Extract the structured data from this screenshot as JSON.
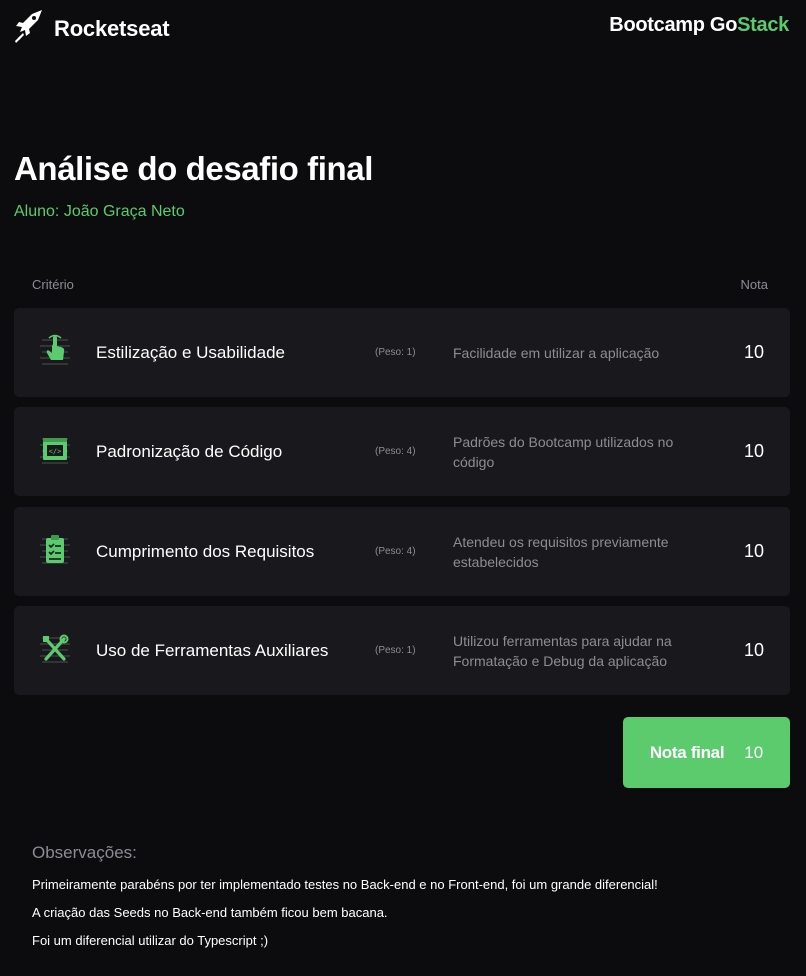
{
  "header": {
    "brand": "Rocketseat",
    "bootcamp_prefix": "Bootcamp Go",
    "bootcamp_suffix": "Stack",
    "logo_icon": "rocket-icon"
  },
  "page": {
    "title": "Análise do desafio final",
    "student": "Aluno: João Graça Neto"
  },
  "table": {
    "col_criterio": "Critério",
    "col_nota": "Nota",
    "rows": [
      {
        "name": "Estilização e Usabilidade",
        "peso": "(Peso: 1)",
        "desc": "Facilidade em utilizar a aplicação",
        "score": "10",
        "icon": "pointer-hand-icon"
      },
      {
        "name": "Padronização de Código",
        "peso": "(Peso: 4)",
        "desc": "Padrões do Bootcamp utilizados no código",
        "score": "10",
        "icon": "code-window-icon"
      },
      {
        "name": "Cumprimento dos Requisitos",
        "peso": "(Peso: 4)",
        "desc": "Atendeu os requisitos previamente estabelecidos",
        "score": "10",
        "icon": "clipboard-check-icon"
      },
      {
        "name": "Uso de Ferramentas Auxiliares",
        "peso": "(Peso: 1)",
        "desc": "Utilizou ferramentas para ajudar na Formatação e Debug da aplicação",
        "score": "10",
        "icon": "tools-icon"
      }
    ]
  },
  "final": {
    "label": "Nota final",
    "value": "10"
  },
  "observations": {
    "title": "Observações:",
    "lines": [
      "Primeiramente parabéns por ter implementado testes no Back-end e no Front-end, foi um grande diferencial!",
      "A criação das Seeds no Back-end também ficou bem bacana.",
      "Foi um diferencial utilizar do Typescript ;)"
    ]
  },
  "colors": {
    "background": "#0c0c0e",
    "card": "#19191d",
    "accent": "#5bcb6e",
    "muted": "#8c8c94"
  }
}
